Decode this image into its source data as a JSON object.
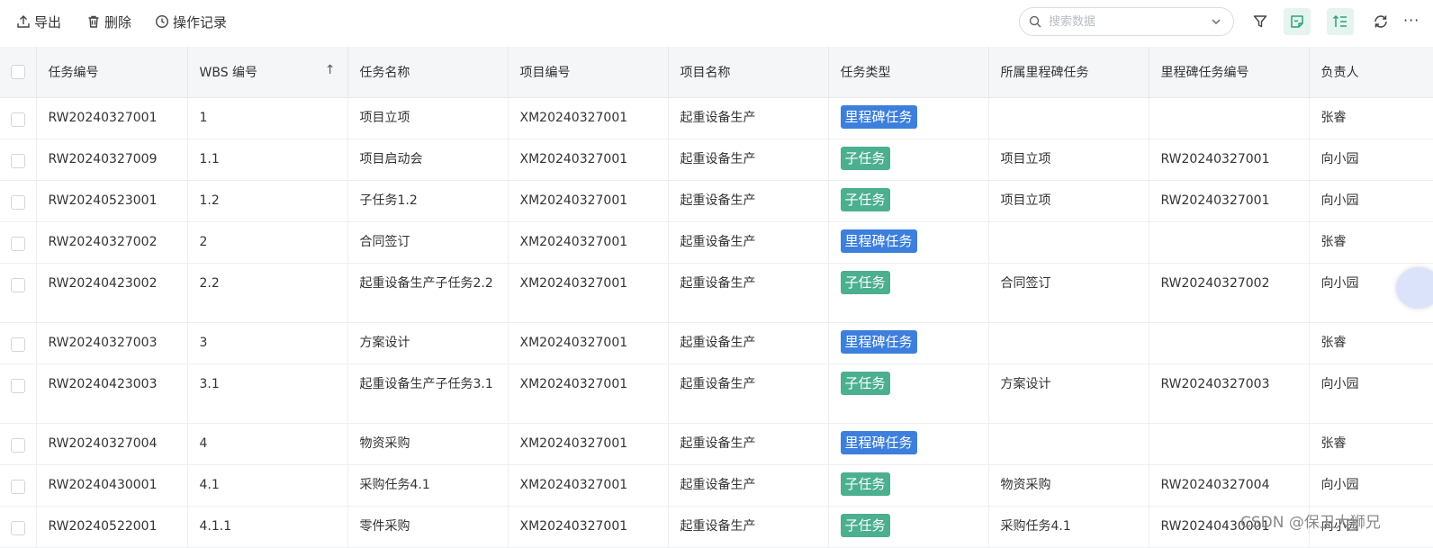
{
  "toolbar": {
    "export_label": "导出",
    "delete_label": "删除",
    "history_label": "操作记录",
    "search_placeholder": "搜索数据",
    "more_label": "···"
  },
  "colors": {
    "milestone_tag": "#3d7fdc",
    "subtask_tag": "#4caf8f",
    "header_bg": "#f5f6f8",
    "active_icon_bg": "#e5f4ef"
  },
  "table": {
    "headers": [
      "任务编号",
      "WBS 编号",
      "任务名称",
      "项目编号",
      "项目名称",
      "任务类型",
      "所属里程碑任务",
      "里程碑任务编号",
      "负责人"
    ],
    "sort_indicator": "↑",
    "rows": [
      {
        "task_no": "RW20240327001",
        "wbs": "1",
        "name": "项目立项",
        "project_no": "XM20240327001",
        "project_name": "起重设备生产",
        "type": "里程碑任务",
        "type_kind": "milestone",
        "milestone": "",
        "milestone_no": "",
        "owner": "张睿"
      },
      {
        "task_no": "RW20240327009",
        "wbs": "1.1",
        "name": "项目启动会",
        "project_no": "XM20240327001",
        "project_name": "起重设备生产",
        "type": "子任务",
        "type_kind": "subtask",
        "milestone": "项目立项",
        "milestone_no": "RW20240327001",
        "owner": "向小园"
      },
      {
        "task_no": "RW20240523001",
        "wbs": "1.2",
        "name": "子任务1.2",
        "project_no": "XM20240327001",
        "project_name": "起重设备生产",
        "type": "子任务",
        "type_kind": "subtask",
        "milestone": "项目立项",
        "milestone_no": "RW20240327001",
        "owner": "向小园"
      },
      {
        "task_no": "RW20240327002",
        "wbs": "2",
        "name": "合同签订",
        "project_no": "XM20240327001",
        "project_name": "起重设备生产",
        "type": "里程碑任务",
        "type_kind": "milestone",
        "milestone": "",
        "milestone_no": "",
        "owner": "张睿"
      },
      {
        "task_no": "RW20240423002",
        "wbs": "2.2",
        "name": "起重设备生产子任务2.2",
        "project_no": "XM20240327001",
        "project_name": "起重设备生产",
        "type": "子任务",
        "type_kind": "subtask",
        "milestone": "合同签订",
        "milestone_no": "RW20240327002",
        "owner": "向小园"
      },
      {
        "task_no": "RW20240327003",
        "wbs": "3",
        "name": "方案设计",
        "project_no": "XM20240327001",
        "project_name": "起重设备生产",
        "type": "里程碑任务",
        "type_kind": "milestone",
        "milestone": "",
        "milestone_no": "",
        "owner": "张睿"
      },
      {
        "task_no": "RW20240423003",
        "wbs": "3.1",
        "name": "起重设备生产子任务3.1",
        "project_no": "XM20240327001",
        "project_name": "起重设备生产",
        "type": "子任务",
        "type_kind": "subtask",
        "milestone": "方案设计",
        "milestone_no": "RW20240327003",
        "owner": "向小园"
      },
      {
        "task_no": "RW20240327004",
        "wbs": "4",
        "name": "物资采购",
        "project_no": "XM20240327001",
        "project_name": "起重设备生产",
        "type": "里程碑任务",
        "type_kind": "milestone",
        "milestone": "",
        "milestone_no": "",
        "owner": "张睿"
      },
      {
        "task_no": "RW20240430001",
        "wbs": "4.1",
        "name": "采购任务4.1",
        "project_no": "XM20240327001",
        "project_name": "起重设备生产",
        "type": "子任务",
        "type_kind": "subtask",
        "milestone": "物资采购",
        "milestone_no": "RW20240327004",
        "owner": "向小园"
      },
      {
        "task_no": "RW20240522001",
        "wbs": "4.1.1",
        "name": "零件采购",
        "project_no": "XM20240327001",
        "project_name": "起重设备生产",
        "type": "子任务",
        "type_kind": "subtask",
        "milestone": "采购任务4.1",
        "milestone_no": "RW20240430001",
        "owner": "向小园"
      }
    ]
  },
  "watermark": "CSDN @保卫大狮兄"
}
